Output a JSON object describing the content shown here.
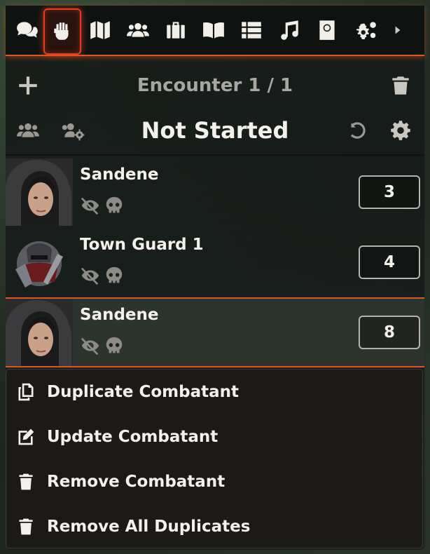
{
  "tabs": [
    {
      "name": "chat",
      "icon": "chat-icon"
    },
    {
      "name": "combat",
      "icon": "fist-icon",
      "active": true
    },
    {
      "name": "scenes",
      "icon": "map-icon"
    },
    {
      "name": "actors",
      "icon": "users-icon"
    },
    {
      "name": "items",
      "icon": "suitcase-icon"
    },
    {
      "name": "journal",
      "icon": "book-open-icon"
    },
    {
      "name": "tables",
      "icon": "list-icon"
    },
    {
      "name": "playlists",
      "icon": "music-icon"
    },
    {
      "name": "compendium",
      "icon": "atlas-icon"
    },
    {
      "name": "settings",
      "icon": "cogs-icon"
    },
    {
      "name": "collapse",
      "icon": "caret-right-icon"
    }
  ],
  "encounter": {
    "title": "Encounter 1 / 1",
    "status": "Not Started"
  },
  "combatants": [
    {
      "name": "Sandene",
      "initiative": "3",
      "active": false
    },
    {
      "name": "Town Guard 1",
      "initiative": "4",
      "active": false
    },
    {
      "name": "Sandene",
      "initiative": "8",
      "active": true
    }
  ],
  "context_menu": [
    {
      "label": "Duplicate Combatant",
      "icon": "copy-icon"
    },
    {
      "label": "Update Combatant",
      "icon": "edit-icon"
    },
    {
      "label": "Remove Combatant",
      "icon": "trash-icon"
    },
    {
      "label": "Remove All Duplicates",
      "icon": "trash-icon"
    }
  ],
  "colors": {
    "accent": "#e0571d",
    "active_tab_border": "#e63d1e"
  }
}
